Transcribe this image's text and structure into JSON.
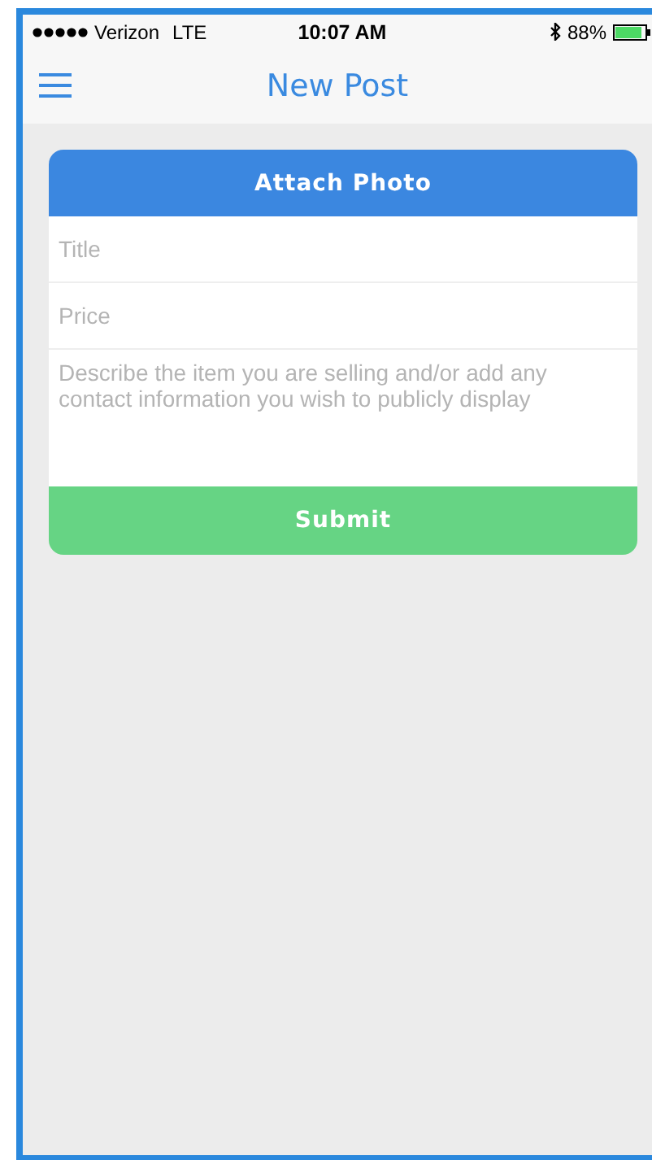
{
  "status_bar": {
    "carrier": "Verizon",
    "network": "LTE",
    "time": "10:07 AM",
    "battery": "88%"
  },
  "nav_bar": {
    "title": "New Post"
  },
  "form": {
    "attach_button": "Attach Photo",
    "fields": [
      {
        "kind": "input",
        "placeholder": "Title"
      },
      {
        "kind": "input",
        "placeholder": "Price"
      },
      {
        "kind": "textarea",
        "placeholder": "Describe the item you are selling and/or add any contact information you wish to publicly display"
      }
    ],
    "submit_button": "Submit"
  }
}
